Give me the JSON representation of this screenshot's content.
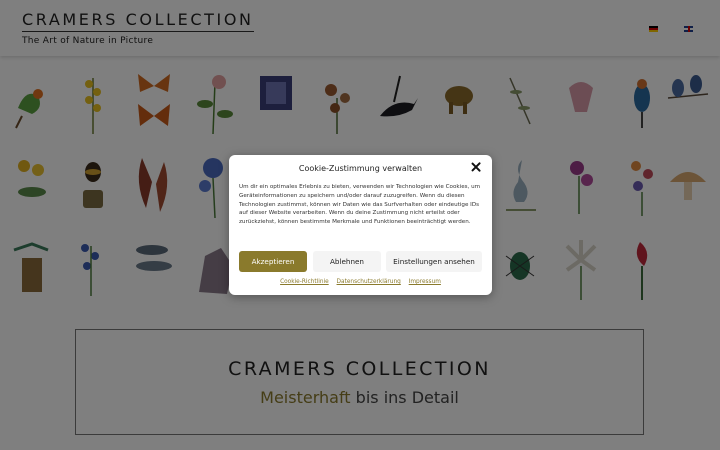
{
  "header": {
    "title": "CRAMERS COLLECTION",
    "tagline": "The Art of Nature in Picture",
    "languages": [
      "de-flag-icon",
      "en-flag-icon"
    ]
  },
  "gallery": {
    "rows": [
      [
        "lovebird-parrots",
        "yellow-flower-branch",
        "orange-butterflies",
        "pink-rose-branch",
        "blue-ornament-box",
        "brown-orchid",
        "black-bird",
        "elephant",
        "leaf-branch",
        "pink-shell",
        "kingfisher",
        "blue-birds"
      ],
      [
        "yellow-orchid",
        "bees",
        "falcons",
        "blue-flowers",
        "",
        "",
        "",
        "",
        "heron",
        "purple-wildflowers",
        "flower-bouquet",
        "mushrooms"
      ],
      [
        "hummingbird-nest",
        "blue-bellflowers",
        "fish",
        "mineral-rock",
        "",
        "",
        "",
        "",
        "beetle",
        "white-lily",
        "red-flower",
        ""
      ]
    ]
  },
  "hero": {
    "title": "CRAMERS COLLECTION",
    "subtitle_accent": "Meisterhaft",
    "subtitle_rest": "bis ins Detail"
  },
  "cookie": {
    "title": "Cookie-Zustimmung verwalten",
    "body": "Um dir ein optimales Erlebnis zu bieten, verwenden wir Technologien wie Cookies, um Geräteinformationen zu speichern und/oder darauf zuzugreifen. Wenn du diesen Technologien zustimmst, können wir Daten wie das Surfverhalten oder eindeutige IDs auf dieser Website verarbeiten. Wenn du deine Zustimmung nicht erteilst oder zurückziehst, können bestimmte Merkmale und Funktionen beeinträchtigt werden.",
    "accept": "Akzeptieren",
    "deny": "Ablehnen",
    "settings": "Einstellungen ansehen",
    "links": [
      "Cookie-Richtlinie",
      "Datenschutzerklärung",
      "Impressum"
    ]
  },
  "colors": {
    "accent": "#8a7a2c",
    "overlay": "rgba(0,0,0,0.5)"
  }
}
